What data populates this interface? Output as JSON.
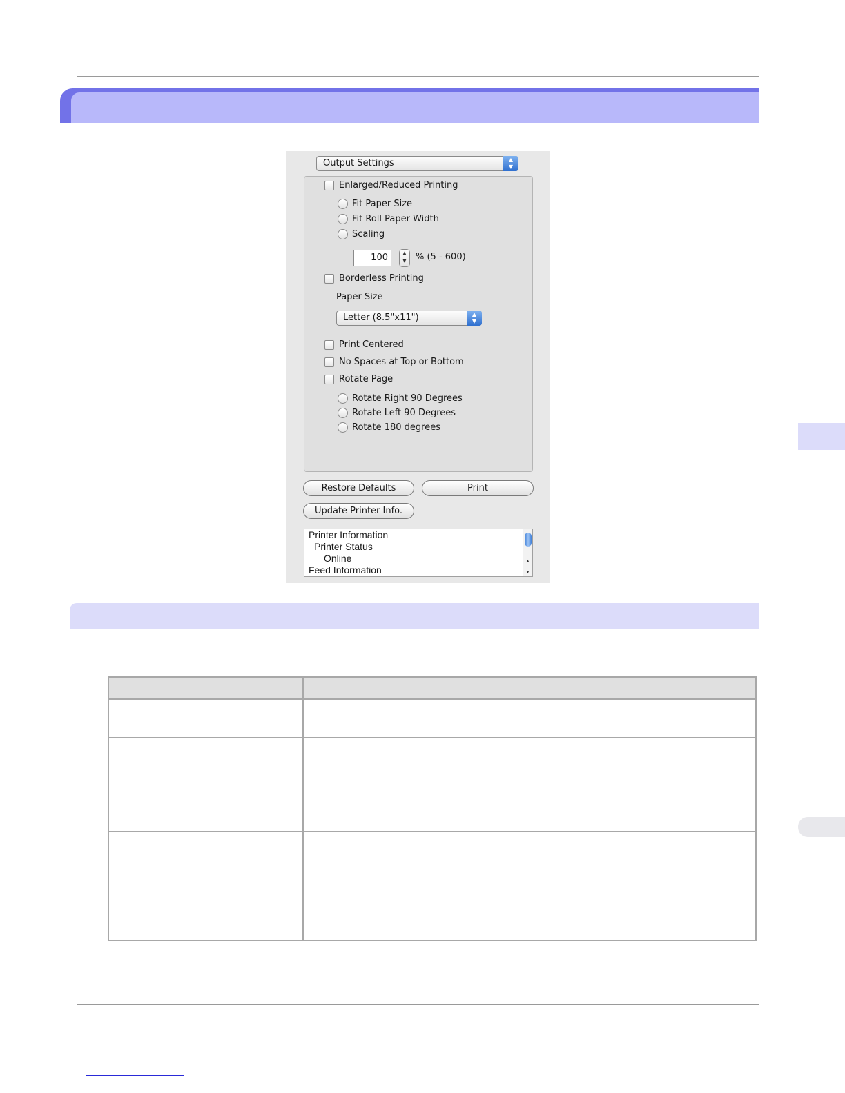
{
  "dialog": {
    "menu_select": "Output Settings",
    "enlarged_reduced_label": "Enlarged/Reduced Printing",
    "fit_paper_size_label": "Fit Paper Size",
    "fit_roll_paper_width_label": "Fit Roll Paper Width",
    "scaling_label": "Scaling",
    "scaling_value": "100",
    "scaling_range": "% (5 - 600)",
    "borderless_label": "Borderless Printing",
    "paper_size_label": "Paper Size",
    "paper_size_value": "Letter (8.5\"x11\")",
    "print_centered_label": "Print Centered",
    "no_spaces_label": "No Spaces at Top or Bottom",
    "rotate_page_label": "Rotate Page",
    "rotate_right_label": "Rotate Right 90 Degrees",
    "rotate_left_label": "Rotate Left 90 Degrees",
    "rotate_180_label": "Rotate 180 degrees",
    "restore_defaults_label": "Restore Defaults",
    "print_label": "Print",
    "update_printer_info_label": "Update Printer Info.",
    "info_lines": [
      "Printer Information",
      "Printer Status",
      "Online",
      "Feed Information"
    ]
  },
  "icons": {
    "select_arrows": "up-down-arrows-icon",
    "stepper": "stepper-arrows-icon"
  },
  "colors": {
    "section_header_dark": "#7272e8",
    "section_header_light": "#b8b8fa",
    "subsection_header": "#dcdcfa",
    "table_header": "#e0e0e0",
    "footer_link": "#2a2ad8"
  }
}
